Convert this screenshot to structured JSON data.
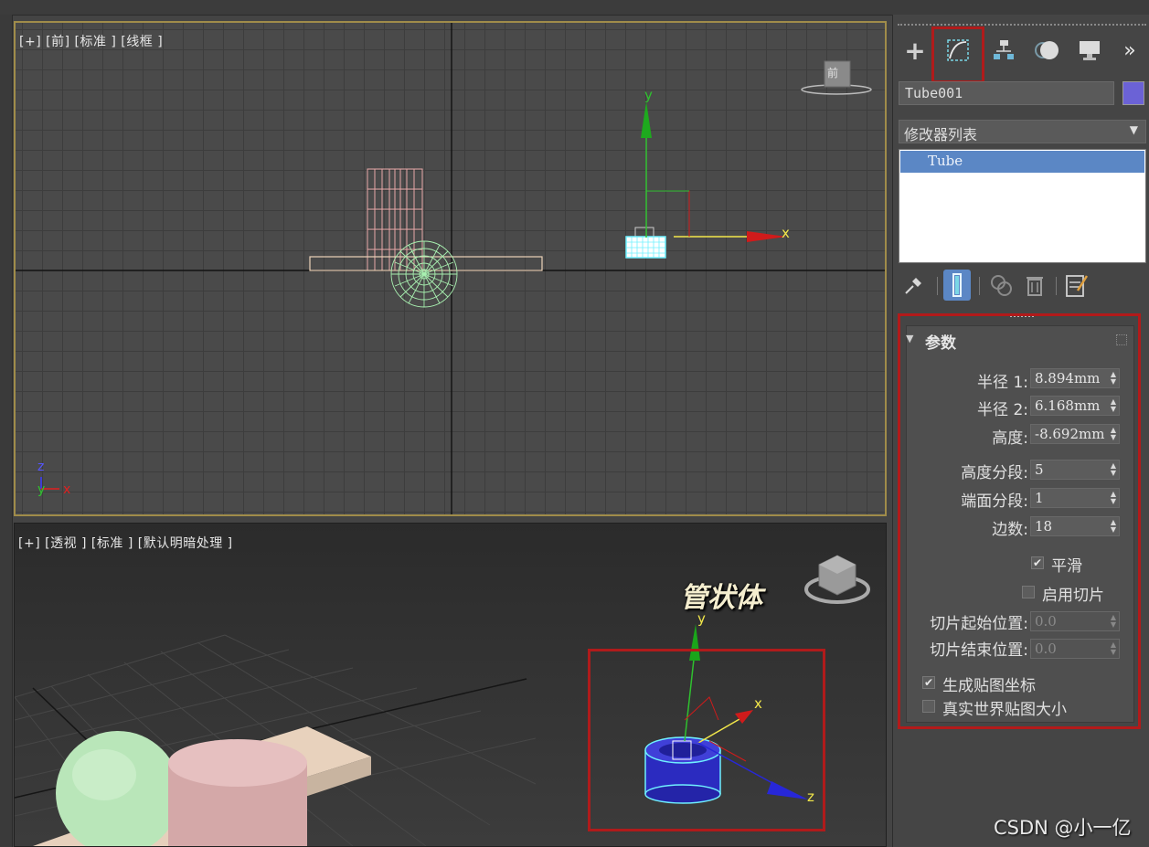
{
  "viewports": {
    "front": {
      "label": "[+] [前] [标准 ] [线框 ]",
      "viewcube_face": "前",
      "gizmo_y": "y",
      "gizmo_x": "x",
      "axis_z": "z",
      "axis_y": "y",
      "axis_x": "x"
    },
    "perspective": {
      "label": "[+] [透视 ] [标准 ] [默认明暗处理 ]",
      "annotation": "管状体",
      "gizmo_y": "y",
      "gizmo_x": "x",
      "gizmo_z": "z"
    }
  },
  "command_panel": {
    "tabs": [
      {
        "name": "create",
        "icon": "plus-icon"
      },
      {
        "name": "modify",
        "icon": "modify-curve-icon",
        "active": true
      },
      {
        "name": "hierarchy",
        "icon": "hierarchy-icon"
      },
      {
        "name": "motion",
        "icon": "motion-icon"
      },
      {
        "name": "display",
        "icon": "display-icon"
      },
      {
        "name": "more",
        "label": "»"
      }
    ],
    "object_name": "Tube001",
    "object_color": "#6b62d6",
    "modifier_list_label": "修改器列表",
    "stack_items": [
      "Tube"
    ],
    "stack_tools": [
      "pin-icon",
      "show-end-result-icon",
      "make-unique-icon",
      "remove-modifier-icon",
      "configure-sets-icon"
    ],
    "params": {
      "rollout_title": "参数",
      "radius1_label": "半径 1:",
      "radius1_value": "8.894mm",
      "radius2_label": "半径 2:",
      "radius2_value": "6.168mm",
      "height_label": "高度:",
      "height_value": "-8.692mm",
      "height_segments_label": "高度分段:",
      "height_segments_value": "5",
      "cap_segments_label": "端面分段:",
      "cap_segments_value": "1",
      "sides_label": "边数:",
      "sides_value": "18",
      "smooth_label": "平滑",
      "smooth_checked": true,
      "slice_on_label": "启用切片",
      "slice_on_checked": false,
      "slice_from_label": "切片起始位置:",
      "slice_from_value": "0.0",
      "slice_to_label": "切片结束位置:",
      "slice_to_value": "0.0",
      "gen_map_coords_label": "生成贴图坐标",
      "gen_map_coords_checked": true,
      "real_world_label": "真实世界贴图大小",
      "real_world_checked": false
    }
  },
  "watermark": "CSDN @小一亿",
  "colors": {
    "highlight_red": "#b01b1b",
    "selection_blue": "#5b87c5",
    "tube_blue": "#3a3ad0",
    "selection_cyan": "#6ff0ff"
  }
}
